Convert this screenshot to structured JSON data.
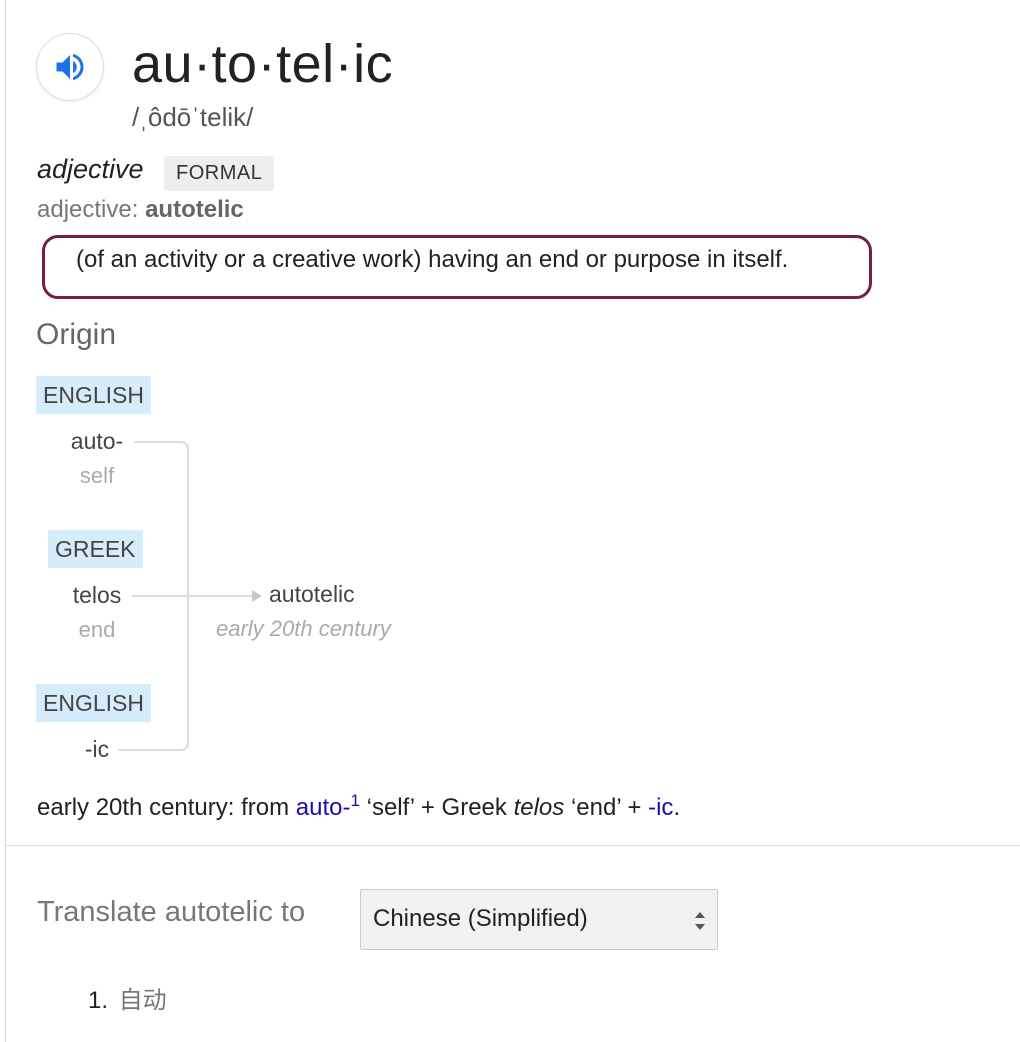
{
  "entry": {
    "headword": "au·to·tel·ic",
    "pronunciation": "/ˌôdōˈtelik/",
    "part_of_speech": "adjective",
    "register_badge": "FORMAL",
    "form_prefix": "adjective:",
    "form_value": "autotelic",
    "definition": "(of an activity or a creative work) having an end or purpose in itself."
  },
  "origin": {
    "title": "Origin",
    "parts": [
      {
        "language": "ENGLISH",
        "morpheme": "auto-",
        "gloss": "self"
      },
      {
        "language": "GREEK",
        "morpheme": "telos",
        "gloss": "end"
      },
      {
        "language": "ENGLISH",
        "morpheme": "-ic",
        "gloss": ""
      }
    ],
    "result_word": "autotelic",
    "result_period": "early 20th century",
    "etymology": {
      "prefix": "early 20th century: from",
      "link1": "auto-",
      "link1_sup": "1",
      "seg1": "‘self’ + Greek",
      "greek_word": "telos",
      "seg2": "‘end’ +",
      "link2": "-ic",
      "end": "."
    }
  },
  "translate": {
    "label": "Translate autotelic to",
    "selected_language": "Chinese (Simplified)",
    "results": [
      {
        "number": "1.",
        "text": "自动"
      }
    ]
  },
  "colors": {
    "highlight_border": "#7b1c45",
    "language_tag_bg": "#d6ecfa",
    "link": "#1a0dab",
    "speaker_icon": "#1a73e8"
  }
}
